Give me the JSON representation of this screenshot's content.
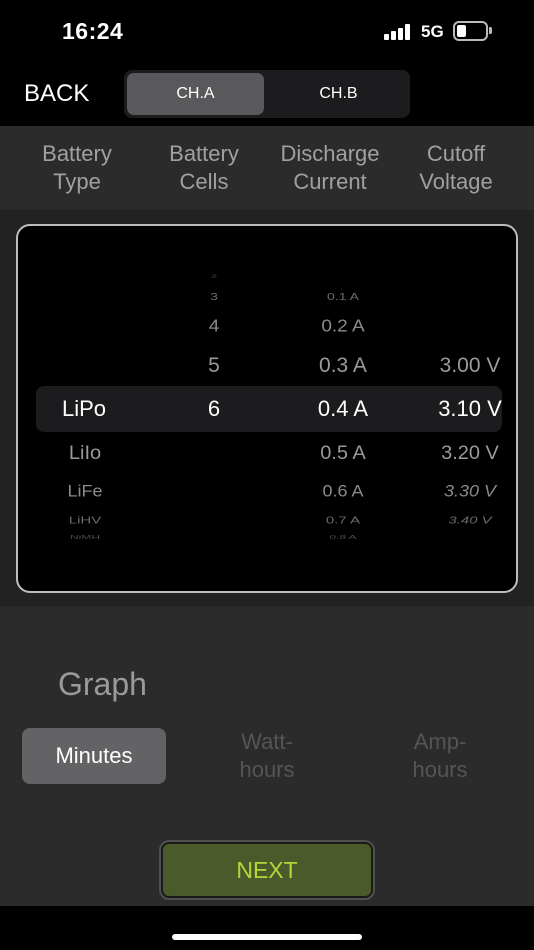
{
  "status_bar": {
    "time": "16:24",
    "network": "5G",
    "battery_icon": "battery-low-icon",
    "signal_icon": "cellular-signal-icon"
  },
  "nav": {
    "back_label": "BACK",
    "channel_a": "CH.A",
    "channel_b": "CH.B",
    "selected": "CH.A"
  },
  "columns": {
    "battery_type": [
      "Battery",
      "Type"
    ],
    "battery_cells": [
      "Battery",
      "Cells"
    ],
    "discharge_current": [
      "Discharge",
      "Current"
    ],
    "cutoff_voltage": [
      "Cutoff",
      "Voltage"
    ]
  },
  "picker": {
    "battery_type": {
      "selected": "LiPo",
      "below": [
        "LiIo",
        "LiFe",
        "LiHV",
        "NiMH"
      ]
    },
    "battery_cells": {
      "above": [
        "2",
        "3",
        "4",
        "5"
      ],
      "selected": "6"
    },
    "discharge_current": {
      "above": [
        "0.1 A",
        "0.2 A",
        "0.3 A"
      ],
      "selected": "0.4 A",
      "below": [
        "0.5 A",
        "0.6 A",
        "0.7 A",
        "0.8 A"
      ]
    },
    "cutoff_voltage": {
      "above": [
        "3.00 V"
      ],
      "selected": "3.10 V",
      "below": [
        "3.20 V",
        "3.30 V",
        "3.40 V"
      ]
    }
  },
  "graph": {
    "label": "Graph",
    "options": [
      "Minutes",
      "Watt-\nhours",
      "Amp-\nhours"
    ],
    "selected": "Minutes",
    "watt_lines": [
      "Watt-",
      "hours"
    ],
    "amp_lines": [
      "Amp-",
      "hours"
    ]
  },
  "next_label": "NEXT",
  "colors": {
    "accent_green_text": "#b5d63a",
    "next_bg": "#4a5a2a",
    "segment_selected": "#59595c"
  }
}
